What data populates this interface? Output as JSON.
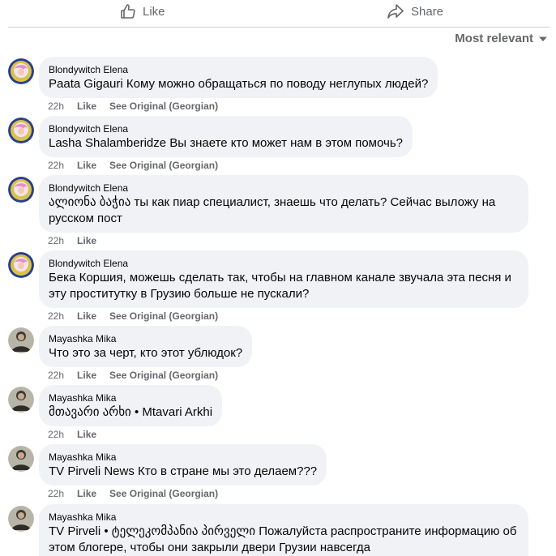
{
  "actions": {
    "like_label": "Like",
    "share_label": "Share"
  },
  "sort": {
    "label": "Most relevant"
  },
  "comments": [
    {
      "author": "Blondywitch Elena",
      "mention": "Paata Gigauri",
      "text": "Кому можно обращаться по поводу неглупых людей?",
      "time": "22h",
      "like": "Like",
      "see_original": "See Original (Georgian)"
    },
    {
      "author": "Blondywitch Elena",
      "mention": "Lasha Shalamberidze",
      "text": "Вы знаете кто может нам в этом помочь?",
      "time": "22h",
      "like": "Like",
      "see_original": "See Original (Georgian)"
    },
    {
      "author": "Blondywitch Elena",
      "mention": "ალიონა ბაჭია",
      "text": "ты как пиар специалист, знаешь что делать? Сейчас выложу на русском пост",
      "time": "22h",
      "like": "Like"
    },
    {
      "author": "Blondywitch Elena",
      "mention": "",
      "text": "Бека Коршия, можешь сделать так, чтобы на главном канале звучала эта песня и эту проститутку в Грузию больше не пускали?",
      "time": "22h",
      "like": "Like",
      "see_original": "See Original (Georgian)"
    },
    {
      "author": "Mayashka Mika",
      "mention": "",
      "text": "Что это за черт, кто этот ублюдок?",
      "time": "22h",
      "like": "Like",
      "see_original": "See Original (Georgian)"
    },
    {
      "author": "Mayashka Mika",
      "mention": "მთავარი არხი • Mtavari Arkhi",
      "text": "",
      "time": "22h",
      "like": "Like"
    },
    {
      "author": "Mayashka Mika",
      "mention": "TV Pirveli News",
      "text": "Кто в стране мы это делаем???",
      "time": "22h",
      "like": "Like",
      "see_original": "See Original (Georgian)"
    },
    {
      "author": "Mayashka Mika",
      "mention": "TV Pirveli • ტელეკომპანია პირველი",
      "text": "Пожалуйста распространите информацию об этом блогере, чтобы они закрыли двери Грузии навсегда"
    }
  ]
}
